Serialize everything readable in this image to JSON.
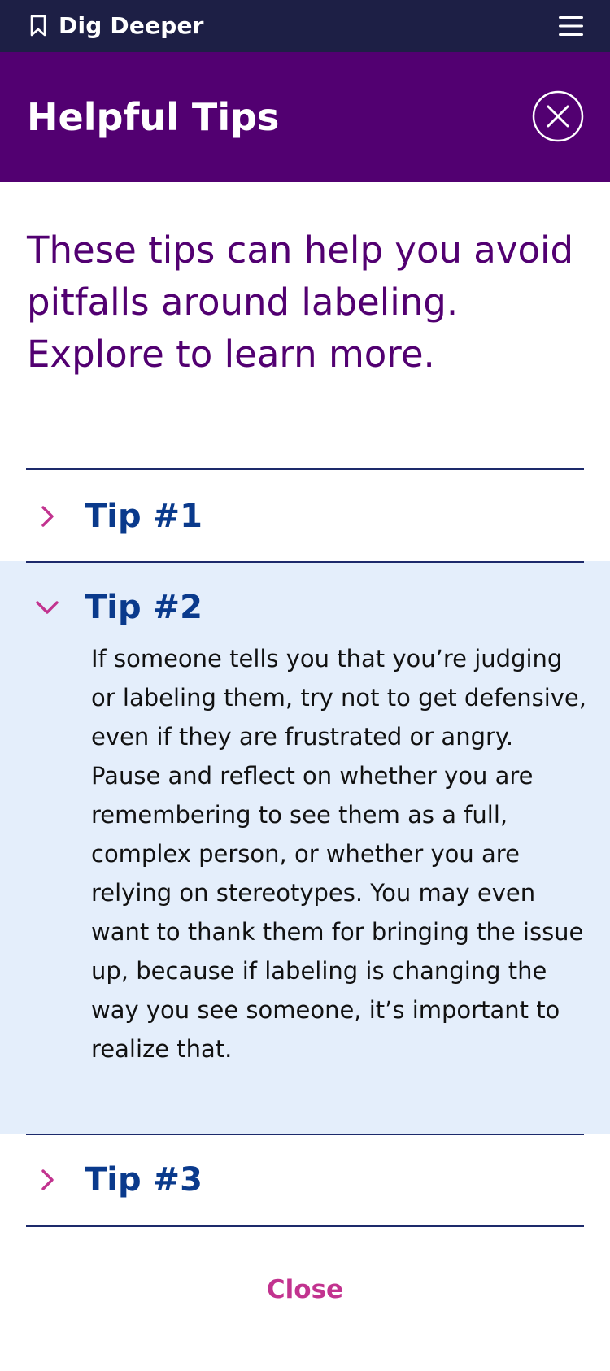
{
  "topbar": {
    "title": "Dig Deeper",
    "bookmark_icon": "bookmark-icon",
    "menu_icon": "hamburger-menu-icon"
  },
  "header": {
    "title": "Helpful Tips",
    "close_icon": "close-circle-icon"
  },
  "intro": "These tips can help you avoid pitfalls around labeling. Explore to learn more.",
  "tips": [
    {
      "label": "Tip #1",
      "expanded": false
    },
    {
      "label": "Tip #2",
      "expanded": true,
      "body": "If someone tells you that you’re judging or labeling them, try not to get defensive, even if they are frustrated or angry. Pause and reflect on whether you are remembering to see them as a full, complex person, or whether you are relying on stereotypes. You may even want to thank them for bringing the issue up, because if labeling is changing the way you see someone, it’s important to realize that."
    },
    {
      "label": "Tip #3",
      "expanded": false
    }
  ],
  "close_label": "Close",
  "colors": {
    "topbar": "#1d1f45",
    "header": "#520071",
    "intro_text": "#520071",
    "tip_label": "#0a3a8c",
    "chevron": "#c2338f",
    "expanded_panel": "#e4eefb",
    "close_link": "#c2338f"
  }
}
